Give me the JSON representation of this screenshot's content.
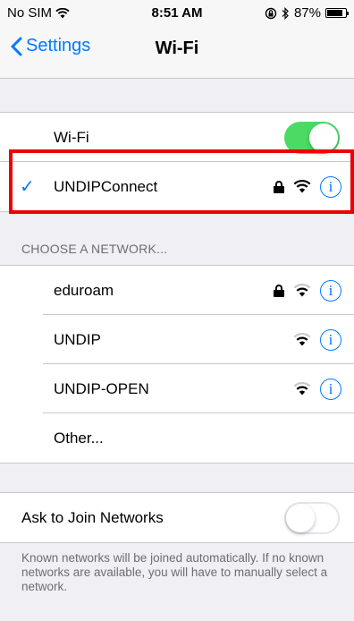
{
  "status_bar": {
    "carrier": "No SIM",
    "time": "8:51 AM",
    "battery": "87%",
    "battery_level": 0.87
  },
  "nav": {
    "back_label": "Settings",
    "title": "Wi-Fi"
  },
  "wifi_toggle": {
    "label": "Wi-Fi",
    "state": "on"
  },
  "connected": {
    "name": "UNDIPConnect",
    "secured": true
  },
  "networks_header": "CHOOSE A NETWORK...",
  "networks": [
    {
      "name": "eduroam",
      "secured": true
    },
    {
      "name": "UNDIP",
      "secured": false
    },
    {
      "name": "UNDIP-OPEN",
      "secured": false
    },
    {
      "name": "Other..."
    }
  ],
  "ask_to_join": {
    "label": "Ask to Join Networks",
    "state": "off",
    "note": "Known networks will be joined automatically. If no known networks are available, you will have to manually select a network."
  },
  "colors": {
    "accent": "#007aff",
    "toggle_on": "#4cd964",
    "highlight": "#ee0000"
  }
}
